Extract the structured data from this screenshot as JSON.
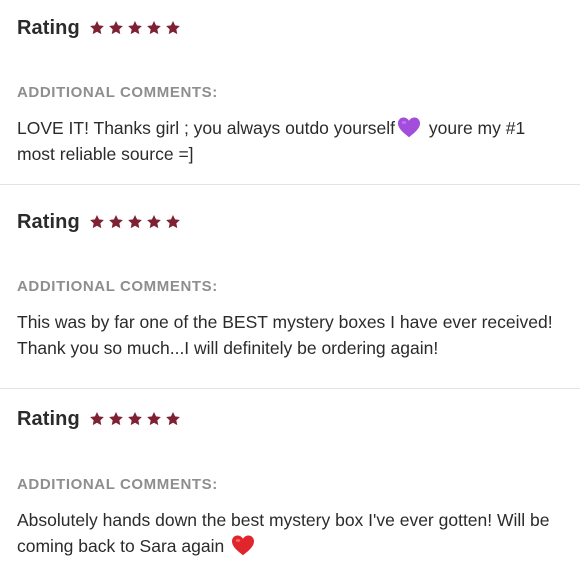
{
  "reviews": [
    {
      "rating_label": "Rating",
      "stars": 5,
      "comments_label": "ADDITIONAL COMMENTS:",
      "text_before_emoji": "LOVE IT! Thanks girl ; you always outdo yourself",
      "emoji": "purple-heart-icon",
      "text_after_emoji": " youre my #1 most reliable source =]"
    },
    {
      "rating_label": "Rating",
      "stars": 5,
      "comments_label": "ADDITIONAL COMMENTS:",
      "text": "This was by far one of the BEST mystery boxes I have ever received! Thank you so much...I will definitely be ordering again!"
    },
    {
      "rating_label": "Rating",
      "stars": 5,
      "comments_label": "ADDITIONAL COMMENTS:",
      "text_before_emoji": "Absolutely hands down the best mystery box I've ever gotten! Will be coming back to Sara again",
      "emoji": "red-heart-icon"
    }
  ],
  "colors": {
    "star": "#7e2233",
    "purple_heart": "#a24ddb",
    "red_heart": "#e1252d"
  }
}
